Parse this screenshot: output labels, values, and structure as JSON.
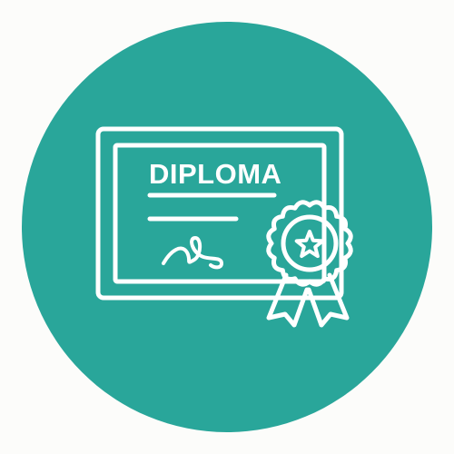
{
  "icon": {
    "name": "diploma-icon",
    "title_text": "DIPLOMA",
    "colors": {
      "page_background": "#fcfcfa",
      "circle": "#29a69a",
      "line": "#ffffff"
    },
    "parts": {
      "frame": "certificate-frame",
      "lines": "text-lines",
      "signature": "signature-scribble",
      "seal": "rosette-seal-icon",
      "star": "star-icon",
      "ribbons": "ribbon-tails-icon"
    }
  }
}
